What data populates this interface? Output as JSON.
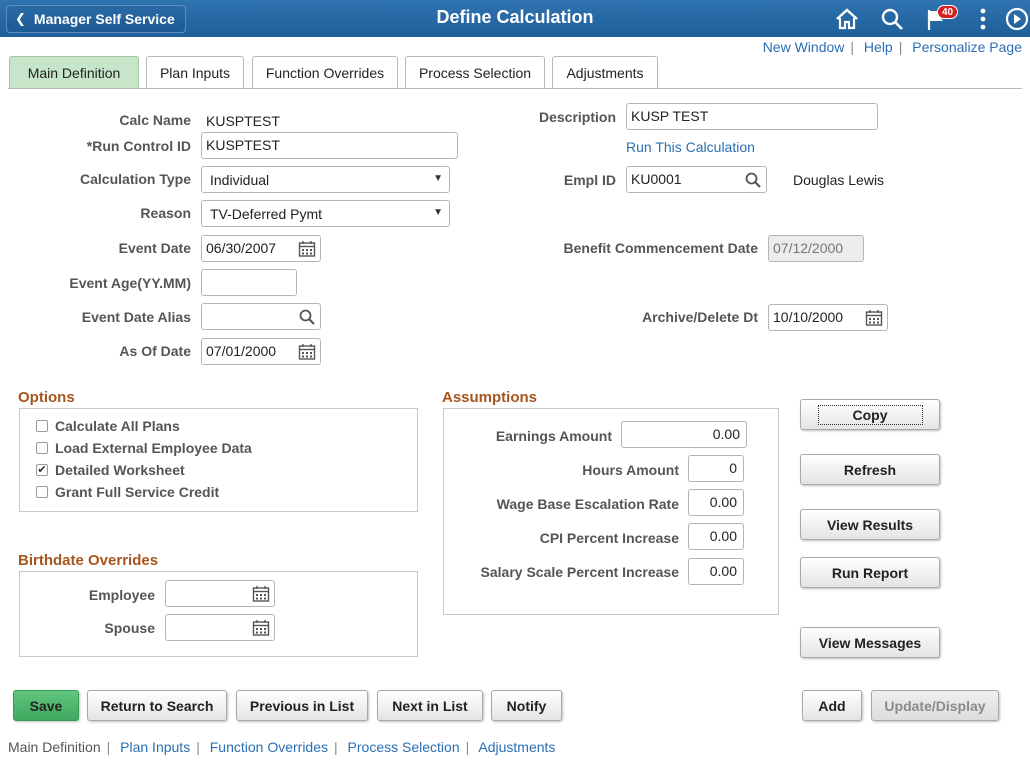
{
  "header": {
    "back_label": "Manager Self Service",
    "title": "Define Calculation",
    "notification_count": "40",
    "icons": [
      "home-icon",
      "search-icon",
      "notification-flag-icon",
      "actions-menu-icon",
      "navbar-icon"
    ]
  },
  "top_links": {
    "new_window": "New Window",
    "help": "Help",
    "personalize": "Personalize Page"
  },
  "tabs": [
    {
      "label": "Main Definition",
      "active": true
    },
    {
      "label": "Plan Inputs",
      "active": false
    },
    {
      "label": "Function Overrides",
      "active": false
    },
    {
      "label": "Process Selection",
      "active": false
    },
    {
      "label": "Adjustments",
      "active": false
    }
  ],
  "form": {
    "calc_name_label": "Calc Name",
    "calc_name_value": "KUSPTEST",
    "run_control_label": "*Run Control ID",
    "run_control_value": "KUSPTEST",
    "calc_type_label": "Calculation Type",
    "calc_type_value": "Individual",
    "reason_label": "Reason",
    "reason_value": "TV-Deferred Pymt",
    "event_date_label": "Event Date",
    "event_date_value": "06/30/2007",
    "event_age_label": "Event Age(YY.MM)",
    "event_age_value": "",
    "event_date_alias_label": "Event Date Alias",
    "event_date_alias_value": "",
    "as_of_date_label": "As Of Date",
    "as_of_date_value": "07/01/2000",
    "description_label": "Description",
    "description_value": "KUSP TEST",
    "run_calc_link": "Run This Calculation",
    "empl_id_label": "Empl ID",
    "empl_id_value": "KU0001",
    "empl_name": "Douglas Lewis",
    "benefit_commencement_label": "Benefit Commencement Date",
    "benefit_commencement_value": "07/12/2000",
    "archive_delete_label": "Archive/Delete Dt",
    "archive_delete_value": "10/10/2000"
  },
  "options": {
    "title": "Options",
    "items": [
      {
        "label": "Calculate All Plans",
        "checked": false
      },
      {
        "label": "Load External Employee Data",
        "checked": false
      },
      {
        "label": "Detailed Worksheet",
        "checked": true
      },
      {
        "label": "Grant Full Service Credit",
        "checked": false
      }
    ]
  },
  "birthdate": {
    "title": "Birthdate Overrides",
    "employee_label": "Employee",
    "employee_value": "",
    "spouse_label": "Spouse",
    "spouse_value": ""
  },
  "assumptions": {
    "title": "Assumptions",
    "earnings_label": "Earnings Amount",
    "earnings_value": "0.00",
    "hours_label": "Hours Amount",
    "hours_value": "0",
    "wage_base_label": "Wage Base Escalation Rate",
    "wage_base_value": "0.00",
    "cpi_label": "CPI Percent Increase",
    "cpi_value": "0.00",
    "salary_scale_label": "Salary Scale Percent Increase",
    "salary_scale_value": "0.00"
  },
  "side_buttons": {
    "copy": "Copy",
    "refresh": "Refresh",
    "view_results": "View Results",
    "run_report": "Run Report",
    "view_messages": "View Messages"
  },
  "bottom_buttons": {
    "save": "Save",
    "return_to_search": "Return to Search",
    "previous_in_list": "Previous in List",
    "next_in_list": "Next in List",
    "notify": "Notify",
    "add": "Add",
    "update_display": "Update/Display"
  },
  "bottom_links": [
    "Main Definition",
    "Plan Inputs",
    "Function Overrides",
    "Process Selection",
    "Adjustments"
  ],
  "colors": {
    "header_blue": "#1e5f99",
    "active_tab_green": "#c6e5c9",
    "section_title_brown": "#a5551d",
    "link_blue": "#2a6fb3",
    "save_green": "#3ea95e",
    "badge_red": "#d21f1f"
  }
}
